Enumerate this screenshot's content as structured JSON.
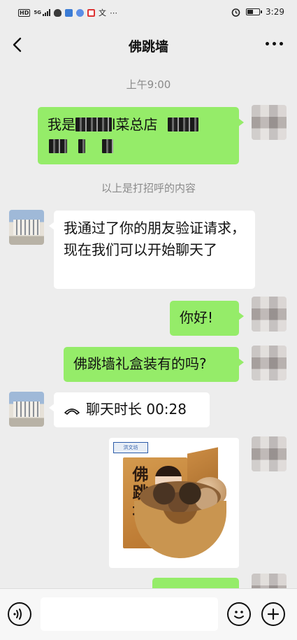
{
  "status_bar": {
    "network_badge": "HD",
    "network_type": "5G",
    "time": "3:29",
    "battery_level": 0.55
  },
  "header": {
    "title": "佛跳墙",
    "back_icon": "chevron-left-icon",
    "more_icon": "more-dots-icon"
  },
  "chat": {
    "timestamp": "上午9:00",
    "system_note": "以上是打招呼的内容",
    "messages": [
      {
        "from": "me",
        "text_start": "我是",
        "text_mid": "l菜总店",
        "text_end": ""
      },
      {
        "from": "them",
        "text": "我通过了你的朋友验证请求，现在我们可以开始聊天了"
      },
      {
        "from": "me",
        "text": "你好!"
      },
      {
        "from": "me",
        "text": "佛跳墙礼盒装有的吗?"
      },
      {
        "from": "them",
        "icon": "phone-icon",
        "text": "聊天时长 00:28"
      },
      {
        "from": "me",
        "type": "image",
        "image_title": "佛跳墙",
        "image_logo": "洪文坊"
      }
    ]
  },
  "input_bar": {
    "voice_icon": "voice-icon",
    "emoji_icon": "emoji-icon",
    "plus_icon": "plus-icon",
    "placeholder": ""
  },
  "colors": {
    "background": "#ededed",
    "my_bubble": "#95ec69",
    "their_bubble": "#ffffff",
    "muted_text": "#8a8a8a"
  }
}
